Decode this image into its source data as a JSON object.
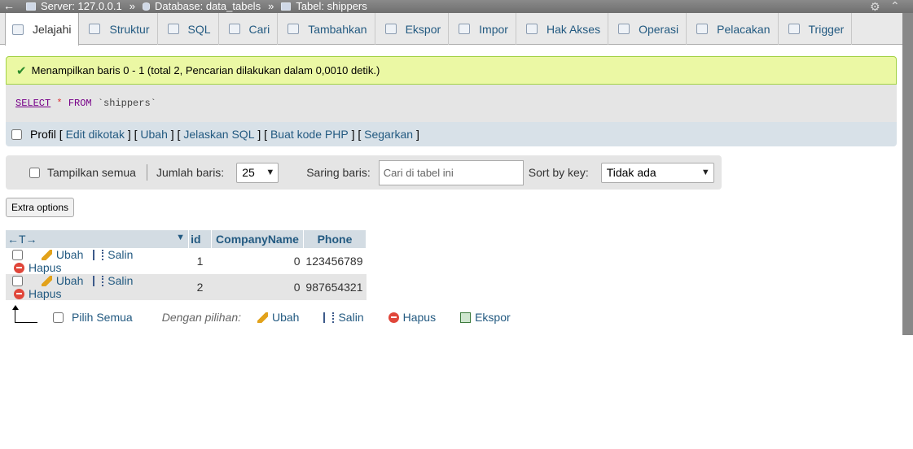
{
  "breadcrumb": {
    "back_glyph": "←",
    "server": "Server: 127.0.0.1",
    "database": "Database: data_tabels",
    "table": "Tabel: shippers",
    "separator": "»"
  },
  "tabs": [
    {
      "label": "Jelajahi",
      "icon": "browse-icon",
      "active": true
    },
    {
      "label": "Struktur",
      "icon": "structure-icon"
    },
    {
      "label": "SQL",
      "icon": "sql-icon"
    },
    {
      "label": "Cari",
      "icon": "search-icon"
    },
    {
      "label": "Tambahkan",
      "icon": "insert-icon"
    },
    {
      "label": "Ekspor",
      "icon": "export-icon"
    },
    {
      "label": "Impor",
      "icon": "import-icon"
    },
    {
      "label": "Hak Akses",
      "icon": "privileges-icon"
    },
    {
      "label": "Operasi",
      "icon": "wrench-icon"
    },
    {
      "label": "Pelacakan",
      "icon": "eye-icon"
    },
    {
      "label": "Trigger",
      "icon": "trigger-icon"
    }
  ],
  "message": "Menampilkan baris 0 - 1 (total 2, Pencarian dilakukan dalam 0,0010 detik.)",
  "sql": {
    "select": "SELECT",
    "star": "*",
    "from": "FROM",
    "table": "`shippers`"
  },
  "profil": {
    "label": "Profil",
    "links": [
      "Edit dikotak",
      "Ubah",
      "Jelaskan SQL",
      "Buat kode PHP",
      "Segarkan"
    ]
  },
  "navbar": {
    "show_all": "Tampilkan semua",
    "rows_label": "Jumlah baris:",
    "rows_value": "25",
    "filter_label": "Saring baris:",
    "filter_placeholder": "Cari di tabel ini",
    "sort_label": "Sort by key:",
    "sort_value": "Tidak ada"
  },
  "extra_options": "Extra options",
  "table": {
    "arrows": "←T→",
    "columns": [
      "id",
      "CompanyName",
      "Phone"
    ],
    "row_actions": {
      "edit": "Ubah",
      "copy": "Salin",
      "delete": "Hapus"
    },
    "rows": [
      {
        "id": "1",
        "CompanyName": "0",
        "Phone": "123456789"
      },
      {
        "id": "2",
        "CompanyName": "0",
        "Phone": "987654321"
      }
    ]
  },
  "footer": {
    "check_all": "Pilih Semua",
    "with_selected": "Dengan pilihan:",
    "actions": [
      "Ubah",
      "Salin",
      "Hapus",
      "Ekspor"
    ]
  },
  "colors": {
    "link": "#235a81",
    "success_bg": "#ebf8a4",
    "header_bg": "#d3dce3"
  }
}
